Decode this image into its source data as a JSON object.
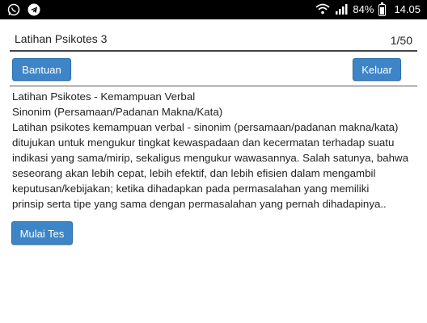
{
  "status_bar": {
    "left_icons": [
      "whatsapp-icon",
      "telegram-icon"
    ],
    "battery": "84%",
    "battery_level": 0.84,
    "time": "14.05",
    "right_icons": [
      "wifi-icon",
      "signal-icon",
      "battery-icon"
    ]
  },
  "header": {
    "title": "Latihan Psikotes 3",
    "counter": "1/50"
  },
  "toolbar": {
    "help_label": "Bantuan",
    "exit_label": "Keluar"
  },
  "content": {
    "heading": "Latihan Psikotes - Kemampuan Verbal",
    "subheading": "Sinonim (Persamaan/Padanan Makna/Kata)",
    "lines": [
      "Latihan psikotes kemampuan verbal - sinonim (persamaan/padanan makna/kata)",
      "ditujukan untuk mengukur tingkat kewaspadaan dan kecermatan terhadap suatu",
      "indikasi yang sama/mirip, sekaligus mengukur wawasannya. Salah satunya, bahwa",
      "seseorang akan lebih cepat, lebih efektif, dan lebih efisien dalam mengambil",
      "keputusan/kebijakan; ketika dihadapkan pada permasalahan yang memiliki",
      "prinsip serta tipe yang sama dengan permasalahan yang pernah dihadapinya.."
    ]
  },
  "actions": {
    "start_label": "Mulai Tes"
  },
  "colors": {
    "button": "#3d85c6",
    "status_bar": "#000000"
  }
}
